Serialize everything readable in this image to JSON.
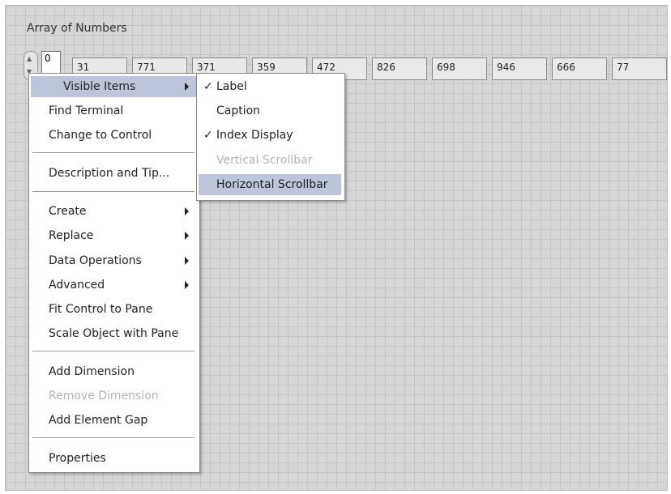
{
  "array": {
    "label": "Array of Numbers",
    "index": "0",
    "values": [
      "31",
      "771",
      "371",
      "359",
      "472",
      "826",
      "698",
      "946",
      "666",
      "77"
    ]
  },
  "context_menu": {
    "items": [
      {
        "label": "Visible Items",
        "submenu": true,
        "highlighted": true
      },
      {
        "label": "Find Terminal"
      },
      {
        "label": "Change to Control"
      },
      {
        "label": "Description and Tip..."
      },
      {
        "label": "Create",
        "submenu": true
      },
      {
        "label": "Replace",
        "submenu": true
      },
      {
        "label": "Data Operations",
        "submenu": true
      },
      {
        "label": "Advanced",
        "submenu": true
      },
      {
        "label": "Fit Control to Pane"
      },
      {
        "label": "Scale Object with Pane"
      },
      {
        "label": "Add Dimension"
      },
      {
        "label": "Remove Dimension",
        "disabled": true
      },
      {
        "label": "Add Element Gap"
      },
      {
        "label": "Properties"
      }
    ]
  },
  "submenu": {
    "items": [
      {
        "label": "Label",
        "checked": true
      },
      {
        "label": "Caption",
        "checked": false
      },
      {
        "label": "Index Display",
        "checked": true
      },
      {
        "label": "Vertical Scrollbar",
        "disabled": true
      },
      {
        "label": "Horizontal Scrollbar",
        "highlighted": true
      }
    ],
    "check_glyph": "✓"
  }
}
